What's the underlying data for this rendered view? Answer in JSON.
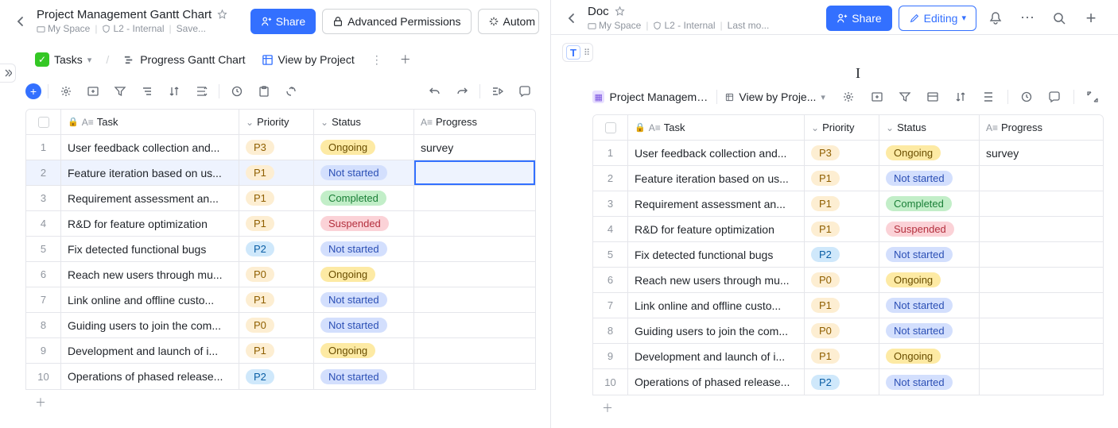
{
  "left": {
    "title": "Project Management Gantt Chart",
    "meta": {
      "space": "My Space",
      "level": "L2 - Internal",
      "save": "Save..."
    },
    "buttons": {
      "share": "Share",
      "permissions": "Advanced Permissions",
      "automation": "Autom"
    },
    "tabs": {
      "tasks": "Tasks",
      "gantt": "Progress Gantt Chart",
      "project": "View by Project"
    },
    "columns": {
      "task": "Task",
      "priority": "Priority",
      "status": "Status",
      "progress": "Progress"
    },
    "rows": [
      {
        "n": "1",
        "task": "User feedback collection and...",
        "pri": "P3",
        "priColor": "#fdeed2",
        "priTxt": "#8f5f00",
        "stat": "Ongoing",
        "statColor": "#fdeaa4",
        "statTxt": "#6a4e00",
        "prog": "survey"
      },
      {
        "n": "2",
        "task": "Feature iteration based on us...",
        "pri": "P1",
        "priColor": "#fdeed2",
        "priTxt": "#8f5f00",
        "stat": "Not started",
        "statColor": "#d3dffd",
        "statTxt": "#2b4fb5",
        "prog": "",
        "selected": true
      },
      {
        "n": "3",
        "task": "Requirement assessment an...",
        "pri": "P1",
        "priColor": "#fdeed2",
        "priTxt": "#8f5f00",
        "stat": "Completed",
        "statColor": "#c2eec8",
        "statTxt": "#1a7f37",
        "prog": ""
      },
      {
        "n": "4",
        "task": "R&D for feature optimization",
        "pri": "P1",
        "priColor": "#fdeed2",
        "priTxt": "#8f5f00",
        "stat": "Suspended",
        "statColor": "#fbd2d7",
        "statTxt": "#b4303e",
        "prog": ""
      },
      {
        "n": "5",
        "task": "Fix detected functional bugs",
        "pri": "P2",
        "priColor": "#cfe8fb",
        "priTxt": "#0b5fa5",
        "stat": "Not started",
        "statColor": "#d3dffd",
        "statTxt": "#2b4fb5",
        "prog": ""
      },
      {
        "n": "6",
        "task": "Reach new users through mu...",
        "pri": "P0",
        "priColor": "#fdeed2",
        "priTxt": "#8f5f00",
        "stat": "Ongoing",
        "statColor": "#fdeaa4",
        "statTxt": "#6a4e00",
        "prog": ""
      },
      {
        "n": "7",
        "task": "Link online and offline custo...",
        "pri": "P1",
        "priColor": "#fdeed2",
        "priTxt": "#8f5f00",
        "stat": "Not started",
        "statColor": "#d3dffd",
        "statTxt": "#2b4fb5",
        "prog": ""
      },
      {
        "n": "8",
        "task": "Guiding users to join the com...",
        "pri": "P0",
        "priColor": "#fdeed2",
        "priTxt": "#8f5f00",
        "stat": "Not started",
        "statColor": "#d3dffd",
        "statTxt": "#2b4fb5",
        "prog": ""
      },
      {
        "n": "9",
        "task": "Development and launch of i...",
        "pri": "P1",
        "priColor": "#fdeed2",
        "priTxt": "#8f5f00",
        "stat": "Ongoing",
        "statColor": "#fdeaa4",
        "statTxt": "#6a4e00",
        "prog": ""
      },
      {
        "n": "10",
        "task": "Operations of phased release...",
        "pri": "P2",
        "priColor": "#cfe8fb",
        "priTxt": "#0b5fa5",
        "stat": "Not started",
        "statColor": "#d3dffd",
        "statTxt": "#2b4fb5",
        "prog": ""
      }
    ]
  },
  "right": {
    "title": "Doc",
    "meta": {
      "space": "My Space",
      "level": "L2 - Internal",
      "save": "Last mo..."
    },
    "buttons": {
      "share": "Share",
      "editing": "Editing"
    },
    "embed": {
      "title": "Project Manageme...",
      "view": "View by Proje..."
    },
    "columns": {
      "task": "Task",
      "priority": "Priority",
      "status": "Status",
      "progress": "Progress"
    },
    "rows": [
      {
        "n": "1",
        "task": "User feedback collection and...",
        "pri": "P3",
        "priColor": "#fdeed2",
        "priTxt": "#8f5f00",
        "stat": "Ongoing",
        "statColor": "#fdeaa4",
        "statTxt": "#6a4e00",
        "prog": "survey"
      },
      {
        "n": "2",
        "task": "Feature iteration based on us...",
        "pri": "P1",
        "priColor": "#fdeed2",
        "priTxt": "#8f5f00",
        "stat": "Not started",
        "statColor": "#d3dffd",
        "statTxt": "#2b4fb5",
        "prog": ""
      },
      {
        "n": "3",
        "task": "Requirement assessment an...",
        "pri": "P1",
        "priColor": "#fdeed2",
        "priTxt": "#8f5f00",
        "stat": "Completed",
        "statColor": "#c2eec8",
        "statTxt": "#1a7f37",
        "prog": ""
      },
      {
        "n": "4",
        "task": "R&D for feature optimization",
        "pri": "P1",
        "priColor": "#fdeed2",
        "priTxt": "#8f5f00",
        "stat": "Suspended",
        "statColor": "#fbd2d7",
        "statTxt": "#b4303e",
        "prog": ""
      },
      {
        "n": "5",
        "task": "Fix detected functional bugs",
        "pri": "P2",
        "priColor": "#cfe8fb",
        "priTxt": "#0b5fa5",
        "stat": "Not started",
        "statColor": "#d3dffd",
        "statTxt": "#2b4fb5",
        "prog": ""
      },
      {
        "n": "6",
        "task": "Reach new users through mu...",
        "pri": "P0",
        "priColor": "#fdeed2",
        "priTxt": "#8f5f00",
        "stat": "Ongoing",
        "statColor": "#fdeaa4",
        "statTxt": "#6a4e00",
        "prog": ""
      },
      {
        "n": "7",
        "task": "Link online and offline custo...",
        "pri": "P1",
        "priColor": "#fdeed2",
        "priTxt": "#8f5f00",
        "stat": "Not started",
        "statColor": "#d3dffd",
        "statTxt": "#2b4fb5",
        "prog": ""
      },
      {
        "n": "8",
        "task": "Guiding users to join the com...",
        "pri": "P0",
        "priColor": "#fdeed2",
        "priTxt": "#8f5f00",
        "stat": "Not started",
        "statColor": "#d3dffd",
        "statTxt": "#2b4fb5",
        "prog": ""
      },
      {
        "n": "9",
        "task": "Development and launch of i...",
        "pri": "P1",
        "priColor": "#fdeed2",
        "priTxt": "#8f5f00",
        "stat": "Ongoing",
        "statColor": "#fdeaa4",
        "statTxt": "#6a4e00",
        "prog": ""
      },
      {
        "n": "10",
        "task": "Operations of phased release...",
        "pri": "P2",
        "priColor": "#cfe8fb",
        "priTxt": "#0b5fa5",
        "stat": "Not started",
        "statColor": "#d3dffd",
        "statTxt": "#2b4fb5",
        "prog": ""
      }
    ]
  }
}
